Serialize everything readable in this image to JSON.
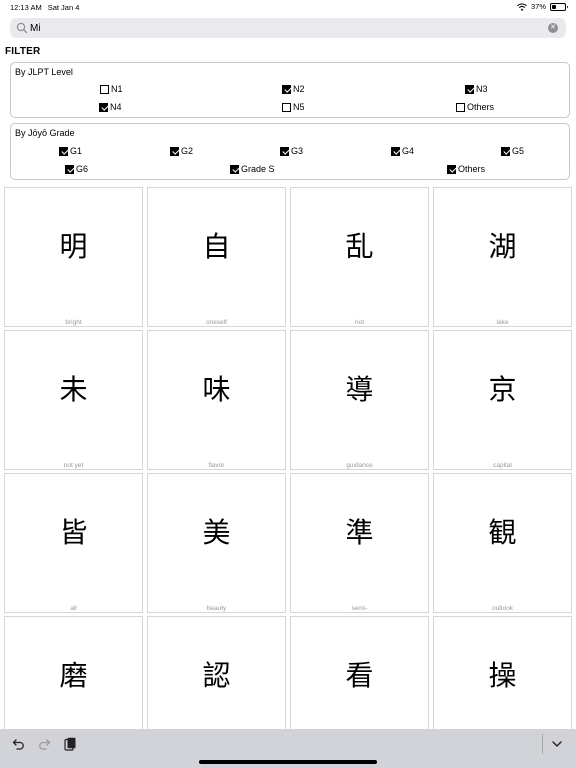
{
  "status_bar": {
    "time": "12:13 AM",
    "date": "Sat Jan 4",
    "battery_text": "37%",
    "battery_level": 0.37
  },
  "search": {
    "value": "Mi",
    "placeholder": ""
  },
  "filter": {
    "title": "FILTER",
    "jlpt": {
      "label": "By JLPT Level",
      "options": [
        {
          "label": "N1",
          "checked": false
        },
        {
          "label": "N2",
          "checked": true
        },
        {
          "label": "N3",
          "checked": true
        },
        {
          "label": "N4",
          "checked": true
        },
        {
          "label": "N5",
          "checked": false
        },
        {
          "label": "Others",
          "checked": false
        }
      ]
    },
    "joyo": {
      "label": "By Jōyō Grade",
      "options": [
        {
          "label": "G1",
          "checked": true
        },
        {
          "label": "G2",
          "checked": true
        },
        {
          "label": "G3",
          "checked": true
        },
        {
          "label": "G4",
          "checked": true
        },
        {
          "label": "G5",
          "checked": true
        },
        {
          "label": "G6",
          "checked": true
        },
        {
          "label": "Grade S",
          "checked": true
        },
        {
          "label": "Others",
          "checked": true
        }
      ]
    }
  },
  "kanji": [
    {
      "char": "明",
      "meaning": "bright"
    },
    {
      "char": "自",
      "meaning": "oneself"
    },
    {
      "char": "乱",
      "meaning": "riot"
    },
    {
      "char": "湖",
      "meaning": "lake"
    },
    {
      "char": "未",
      "meaning": "not yet"
    },
    {
      "char": "味",
      "meaning": "flavor"
    },
    {
      "char": "導",
      "meaning": "guidance"
    },
    {
      "char": "京",
      "meaning": "capital"
    },
    {
      "char": "皆",
      "meaning": "all"
    },
    {
      "char": "美",
      "meaning": "beauty"
    },
    {
      "char": "準",
      "meaning": "semi-"
    },
    {
      "char": "観",
      "meaning": "outlook"
    },
    {
      "char": "磨",
      "meaning": ""
    },
    {
      "char": "認",
      "meaning": ""
    },
    {
      "char": "看",
      "meaning": ""
    },
    {
      "char": "操",
      "meaning": ""
    }
  ],
  "toolbar": {
    "undo_icon": "undo-icon",
    "redo_icon": "redo-icon",
    "paste_icon": "clipboard-icon",
    "dismiss_icon": "chevron-down-icon"
  }
}
